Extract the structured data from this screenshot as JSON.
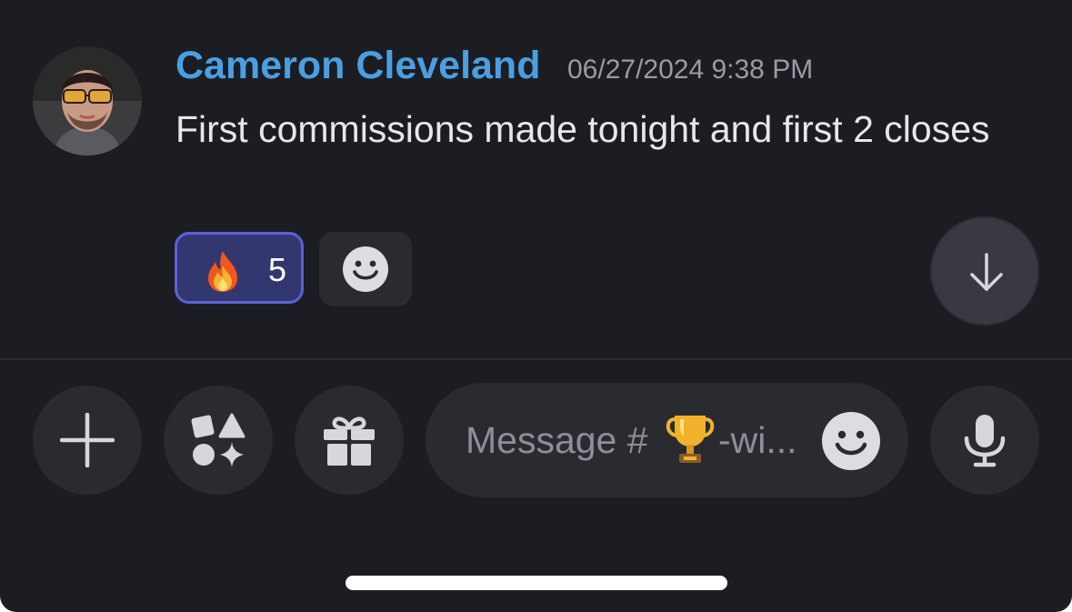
{
  "message": {
    "author": "Cameron Cleveland",
    "timestamp": "06/27/2024 9:38 PM",
    "text": "First commissions made tonight and first 2 closes",
    "reactions": [
      {
        "emoji": "fire",
        "count": "5",
        "selected": true
      }
    ]
  },
  "composer": {
    "placeholder_prefix": "Message #",
    "placeholder_suffix": "-wi..."
  },
  "colors": {
    "background": "#1c1d22",
    "author_name": "#4a9fe2",
    "reaction_selected_bg": "#33376f",
    "reaction_selected_border": "#5b61d9",
    "button_bg": "#2a2b31"
  },
  "icons": {
    "add": "plus-icon",
    "apps": "apps-icon",
    "gift": "gift-icon",
    "mic": "microphone-icon",
    "emoji": "smiley-icon",
    "jump": "arrow-down-icon"
  }
}
